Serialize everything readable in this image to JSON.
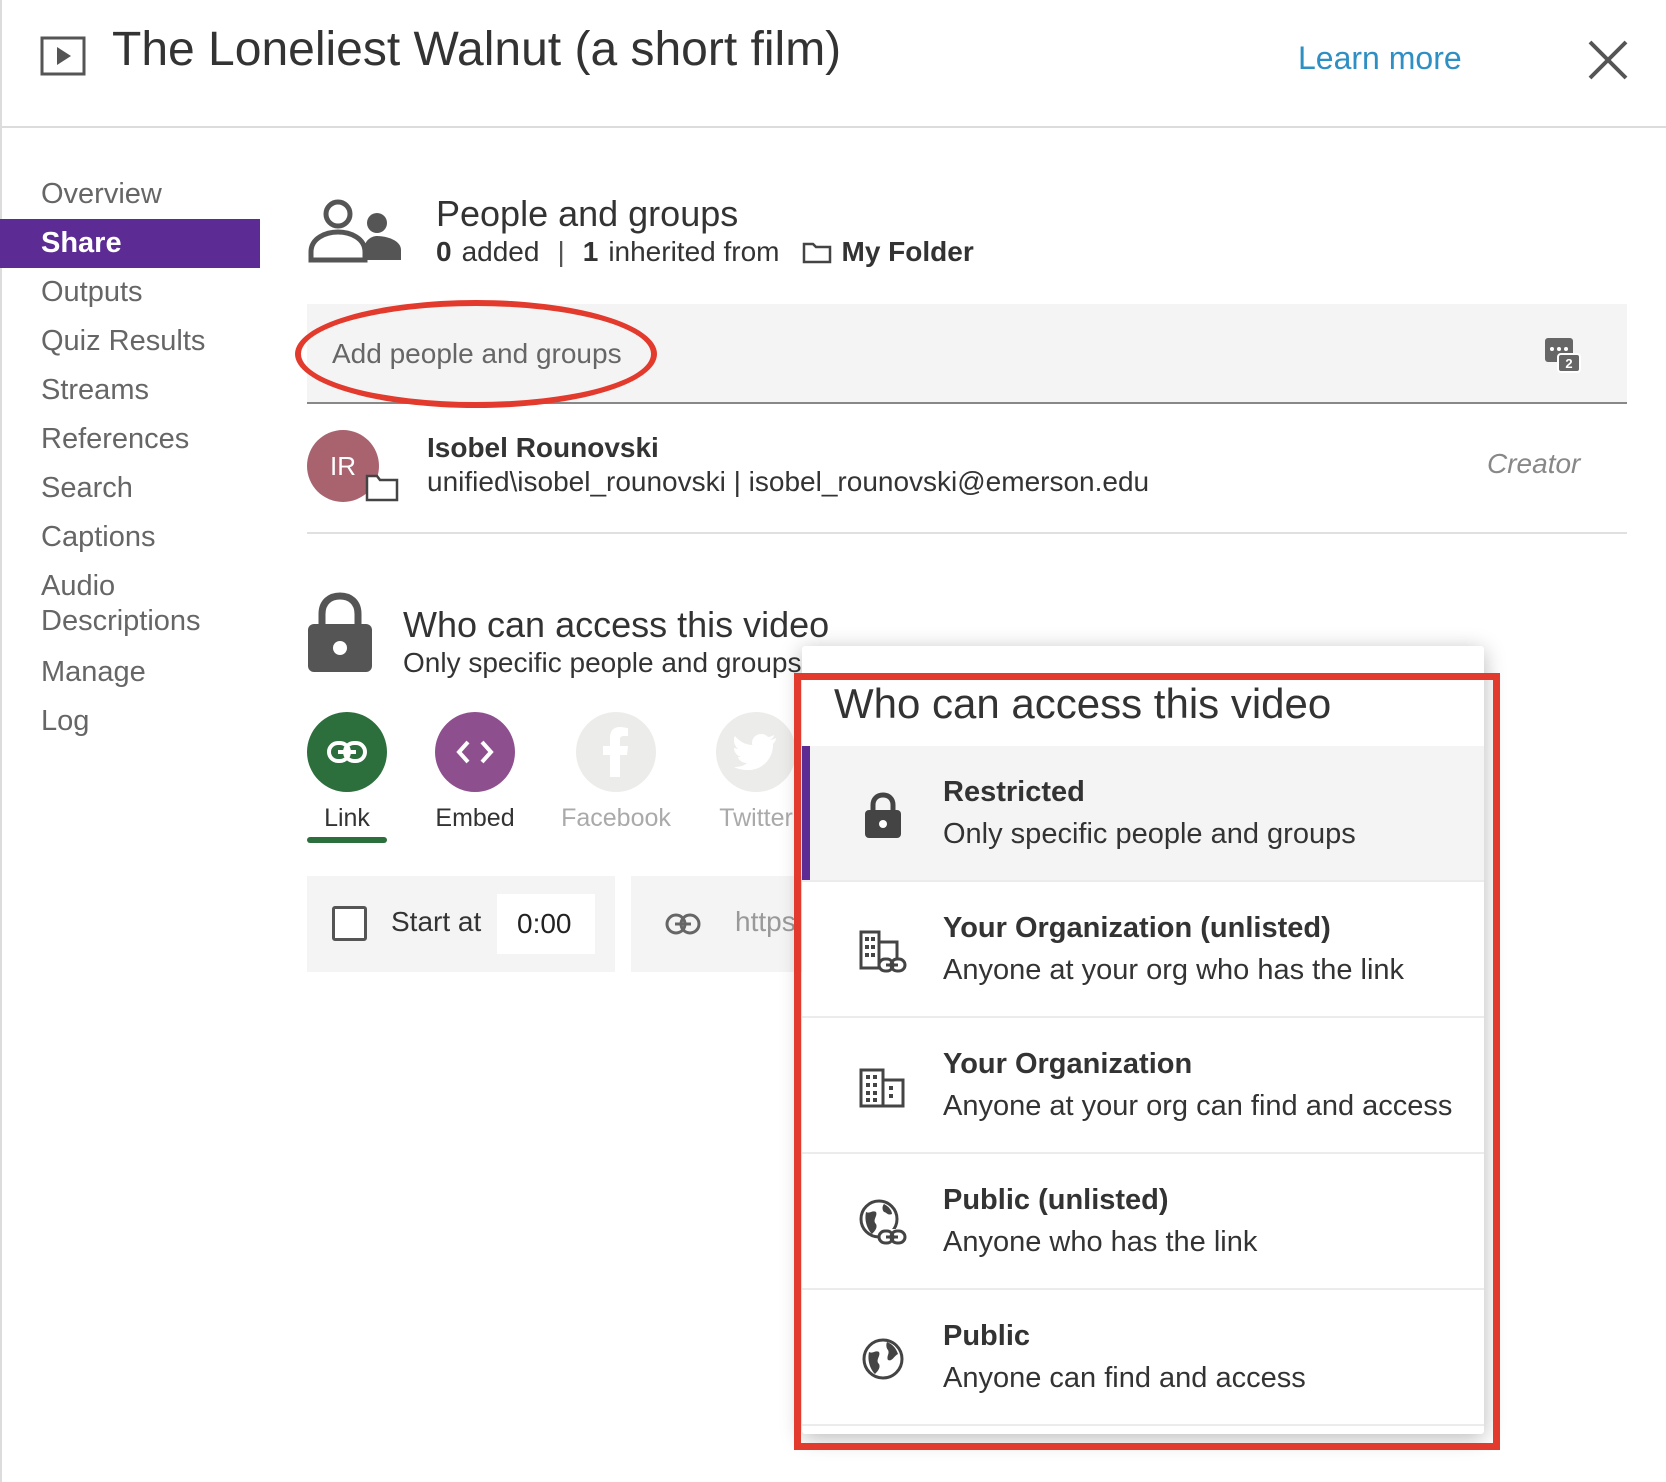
{
  "header": {
    "title": "The Loneliest Walnut (a short film)",
    "learn_more": "Learn more"
  },
  "sidebar": {
    "items": [
      {
        "label": "Overview"
      },
      {
        "label": "Share"
      },
      {
        "label": "Outputs"
      },
      {
        "label": "Quiz Results"
      },
      {
        "label": "Streams"
      },
      {
        "label": "References"
      },
      {
        "label": "Search"
      },
      {
        "label": "Captions"
      },
      {
        "label": "Audio Descriptions"
      },
      {
        "label": "Manage"
      },
      {
        "label": "Log"
      }
    ],
    "active": "Share"
  },
  "people": {
    "title": "People and groups",
    "added_count": "0",
    "added_label": "added",
    "inherited_count": "1",
    "inherited_label": "inherited from",
    "folder_name": "My Folder",
    "add_placeholder": "Add people and groups",
    "person": {
      "initials": "IR",
      "name": "Isobel Rounovski",
      "detail": "unified\\isobel_rounovski | isobel_rounovski@emerson.edu",
      "role": "Creator"
    }
  },
  "access": {
    "title": "Who can access this video",
    "current": "Only specific people and groups"
  },
  "share_buttons": [
    {
      "label": "Link"
    },
    {
      "label": "Embed"
    },
    {
      "label": "Facebook"
    },
    {
      "label": "Twitter"
    }
  ],
  "link_options": {
    "start_at_label": "Start at",
    "start_time": "0:00",
    "url_prefix": "https"
  },
  "dropdown": {
    "title": "Who can access this video",
    "options": [
      {
        "title": "Restricted",
        "desc": "Only specific people and groups",
        "icon": "lock-icon"
      },
      {
        "title": "Your Organization (unlisted)",
        "desc": "Anyone at your org who has the link",
        "icon": "org-link-icon"
      },
      {
        "title": "Your Organization",
        "desc": "Anyone at your org can find and access",
        "icon": "org-icon"
      },
      {
        "title": "Public (unlisted)",
        "desc": "Anyone who has the link",
        "icon": "globe-link-icon"
      },
      {
        "title": "Public",
        "desc": "Anyone can find and access",
        "icon": "globe-icon"
      }
    ],
    "selected": "Restricted"
  },
  "colors": {
    "accent_purple": "#5c2c94",
    "link_green": "#2c6e3c",
    "embed_purple": "#8e4f8e",
    "annotation_red": "#e23a2c",
    "learn_more_blue": "#2e8fc4"
  }
}
